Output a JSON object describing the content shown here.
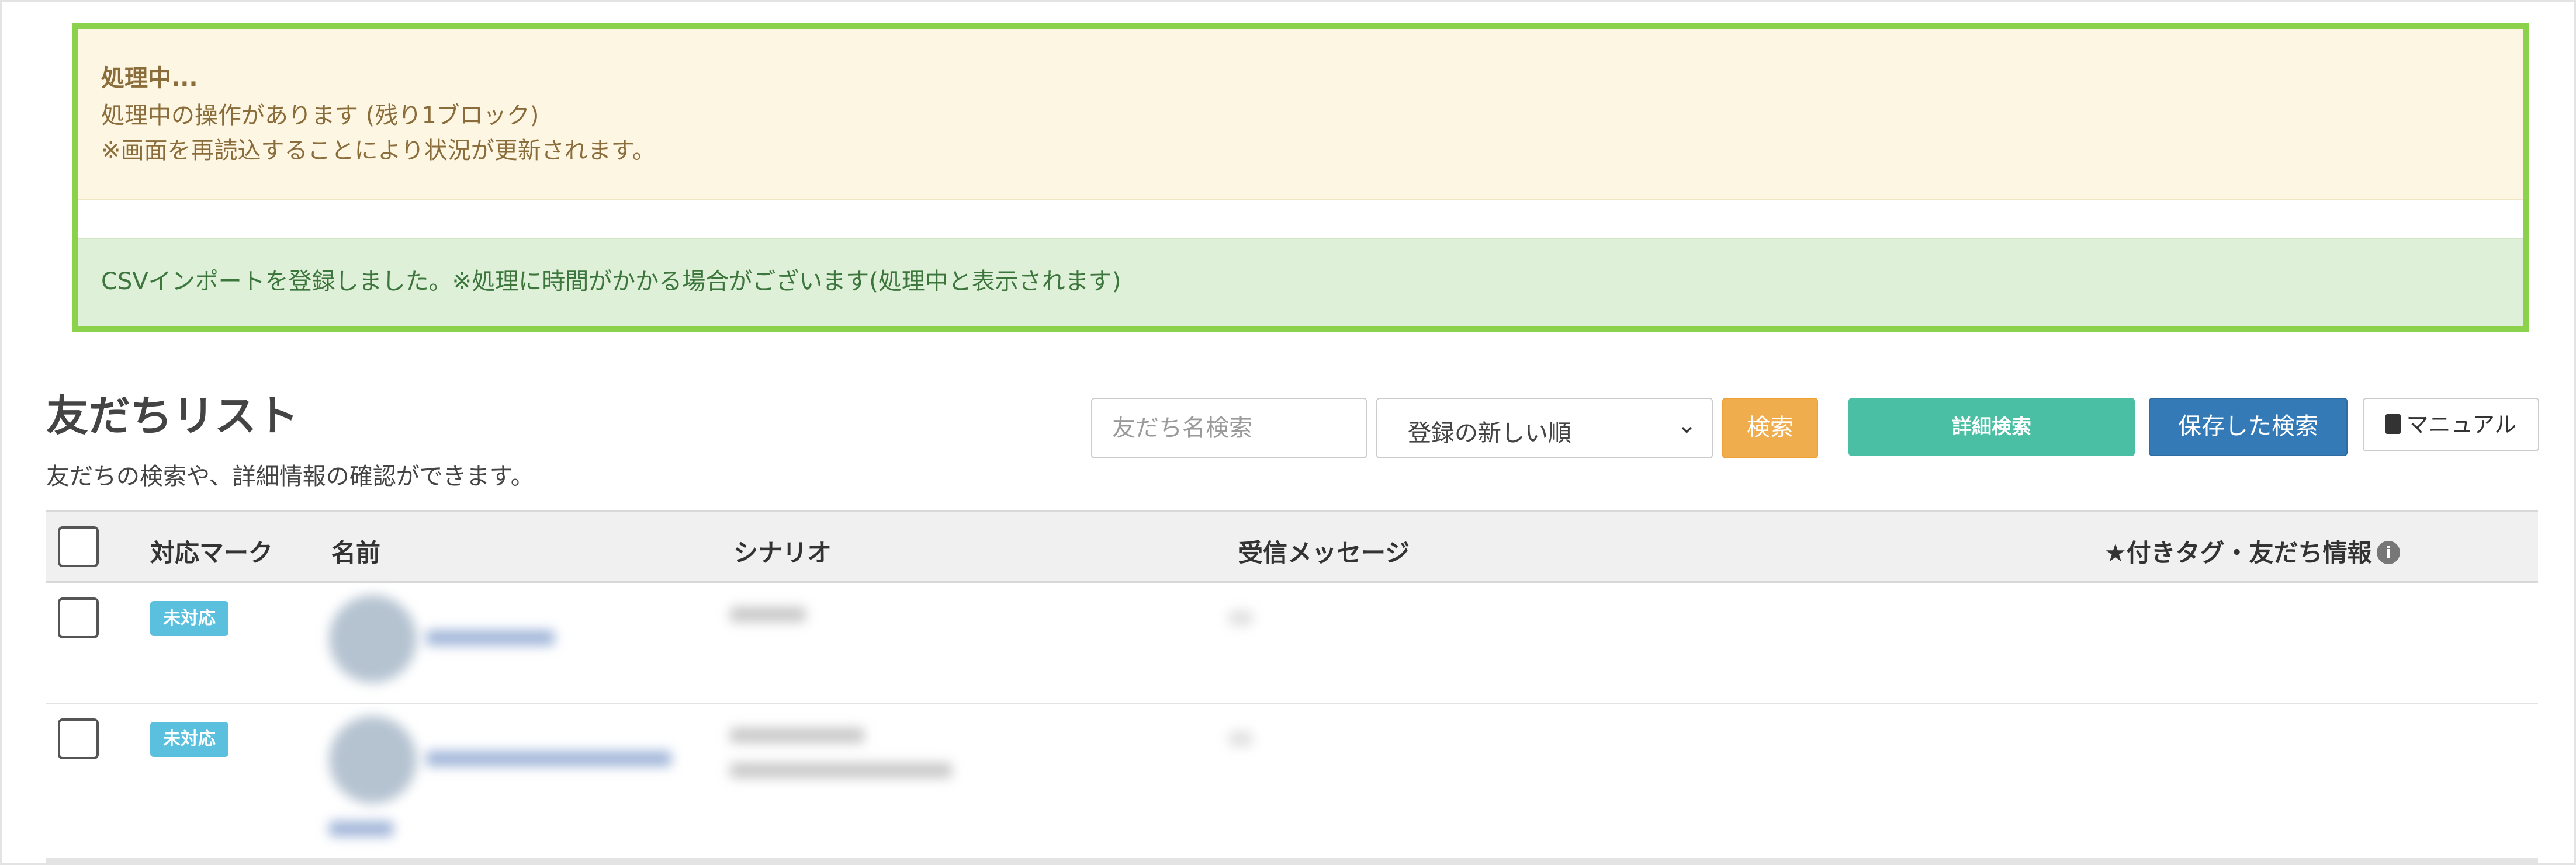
{
  "notice": {
    "processing_title": "処理中...",
    "processing_remaining": "処理中の操作があります (残り1ブロック)",
    "processing_hint": "※画面を再読込することにより状況が更新されます。",
    "success_message": "CSVインポートを登録しました。※処理に時間がかかる場合がございます(処理中と表示されます)"
  },
  "page": {
    "title": "友だちリスト",
    "subtitle": "友だちの検索や、詳細情報の確認ができます。"
  },
  "toolbar": {
    "search_placeholder": "友だち名検索",
    "sort_selected": "登録の新しい順",
    "search_button": "検索",
    "detail_search_button": "詳細検索",
    "saved_search_button": "保存した検索",
    "manual_button": "マニュアル"
  },
  "table": {
    "columns": {
      "status_mark": "対応マーク",
      "name": "名前",
      "scenario": "シナリオ",
      "received_message": "受信メッセージ",
      "tags": "★付きタグ・友だち情報"
    },
    "rows": [
      {
        "status": "未対応"
      },
      {
        "status": "未対応"
      }
    ]
  },
  "colors": {
    "highlight_border": "#8cd14b",
    "warning_bg": "#fdf6e3",
    "success_bg": "#dff0d8",
    "search_button": "#f0ad4e",
    "detail_button": "#4bbfa3",
    "saved_button": "#337ab7",
    "badge": "#5bc0de"
  },
  "icons": [
    "chevron-down-icon",
    "book-icon",
    "info-icon"
  ]
}
